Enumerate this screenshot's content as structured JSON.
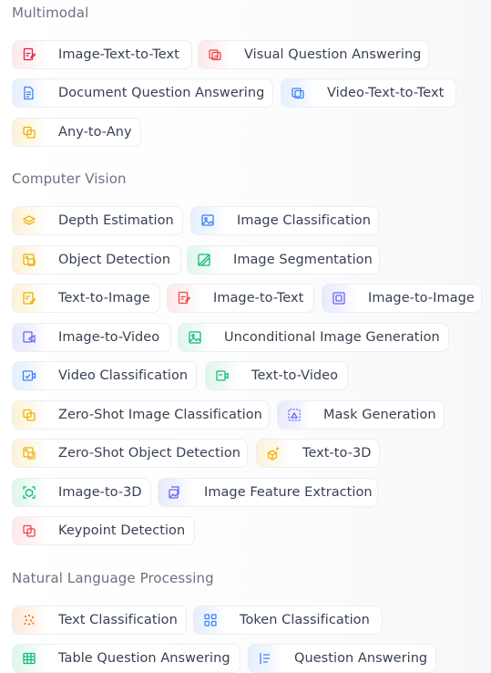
{
  "sections": [
    {
      "title": "Multimodal",
      "tasks": [
        {
          "label": "Image-Text-to-Text",
          "icon": "image-text-to-text-icon",
          "color": "#e11d48"
        },
        {
          "label": "Visual Question Answering",
          "icon": "visual-question-answering-icon",
          "color": "#ef4444"
        },
        {
          "label": "Document Question Answering",
          "icon": "document-question-answering-icon",
          "color": "#3b82f6"
        },
        {
          "label": "Video-Text-to-Text",
          "icon": "video-text-to-text-icon",
          "color": "#3b82f6"
        },
        {
          "label": "Any-to-Any",
          "icon": "any-to-any-icon",
          "color": "#eab308"
        }
      ]
    },
    {
      "title": "Computer Vision",
      "tasks": [
        {
          "label": "Depth Estimation",
          "icon": "depth-estimation-icon",
          "color": "#eab308"
        },
        {
          "label": "Image Classification",
          "icon": "image-classification-icon",
          "color": "#3b82f6"
        },
        {
          "label": "Object Detection",
          "icon": "object-detection-icon",
          "color": "#eab308"
        },
        {
          "label": "Image Segmentation",
          "icon": "image-segmentation-icon",
          "color": "#10b981"
        },
        {
          "label": "Text-to-Image",
          "icon": "text-to-image-icon",
          "color": "#eab308"
        },
        {
          "label": "Image-to-Text",
          "icon": "image-to-text-icon",
          "color": "#ef4444"
        },
        {
          "label": "Image-to-Image",
          "icon": "image-to-image-icon",
          "color": "#6366f1"
        },
        {
          "label": "Image-to-Video",
          "icon": "image-to-video-icon",
          "color": "#6366f1"
        },
        {
          "label": "Unconditional Image Generation",
          "icon": "unconditional-image-generation-icon",
          "color": "#10b981"
        },
        {
          "label": "Video Classification",
          "icon": "video-classification-icon",
          "color": "#3b82f6"
        },
        {
          "label": "Text-to-Video",
          "icon": "text-to-video-icon",
          "color": "#10b981"
        },
        {
          "label": "Zero-Shot Image Classification",
          "icon": "zero-shot-image-classification-icon",
          "color": "#eab308"
        },
        {
          "label": "Mask Generation",
          "icon": "mask-generation-icon",
          "color": "#6366f1"
        },
        {
          "label": "Zero-Shot Object Detection",
          "icon": "zero-shot-object-detection-icon",
          "color": "#eab308"
        },
        {
          "label": "Text-to-3D",
          "icon": "text-to-3d-icon",
          "color": "#eab308"
        },
        {
          "label": "Image-to-3D",
          "icon": "image-to-3d-icon",
          "color": "#10b981"
        },
        {
          "label": "Image Feature Extraction",
          "icon": "image-feature-extraction-icon",
          "color": "#6366f1"
        },
        {
          "label": "Keypoint Detection",
          "icon": "keypoint-detection-icon",
          "color": "#ef4444"
        }
      ]
    },
    {
      "title": "Natural Language Processing",
      "tasks": [
        {
          "label": "Text Classification",
          "icon": "text-classification-icon",
          "color": "#f97316"
        },
        {
          "label": "Token Classification",
          "icon": "token-classification-icon",
          "color": "#3b82f6"
        },
        {
          "label": "Table Question Answering",
          "icon": "table-question-answering-icon",
          "color": "#10b981"
        },
        {
          "label": "Question Answering",
          "icon": "question-answering-icon",
          "color": "#3b82f6"
        }
      ]
    }
  ]
}
